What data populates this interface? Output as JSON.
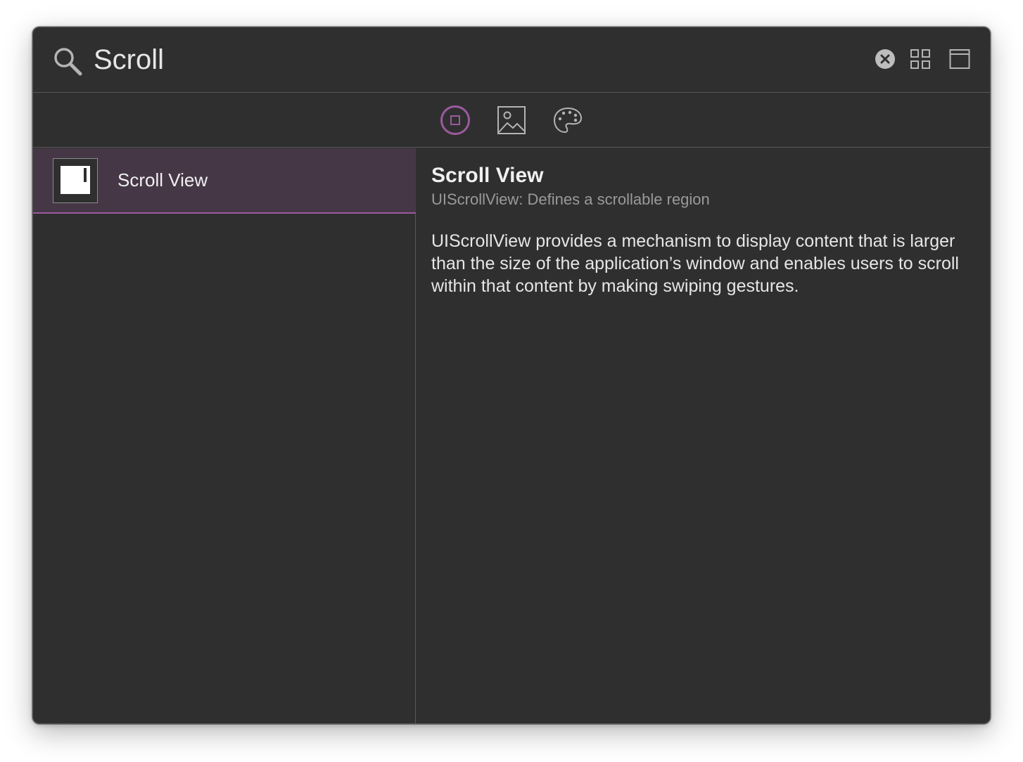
{
  "search": {
    "value": "Scroll",
    "placeholder": ""
  },
  "toolbar": {
    "clear_icon": "clear-icon",
    "grid_icon": "grid-view-icon",
    "window_icon": "window-icon"
  },
  "filters": [
    {
      "icon": "objects-icon",
      "active": true
    },
    {
      "icon": "media-icon",
      "active": false
    },
    {
      "icon": "colors-icon",
      "active": false
    }
  ],
  "results": [
    {
      "label": "Scroll View",
      "icon": "scroll-view-icon",
      "selected": true
    }
  ],
  "detail": {
    "title": "Scroll View",
    "subtitle": "UIScrollView: Defines a scrollable region",
    "description": "UIScrollView provides a mechanism to display content that is larger than the size of the application’s window and enables users to scroll within that content by making swiping gestures."
  },
  "colors": {
    "background": "#2f2f2f",
    "accent": "#9a5a9e",
    "selection": "#463746",
    "text": "#f0f0f0",
    "muted": "#9a9a9a",
    "divider": "#585858"
  }
}
